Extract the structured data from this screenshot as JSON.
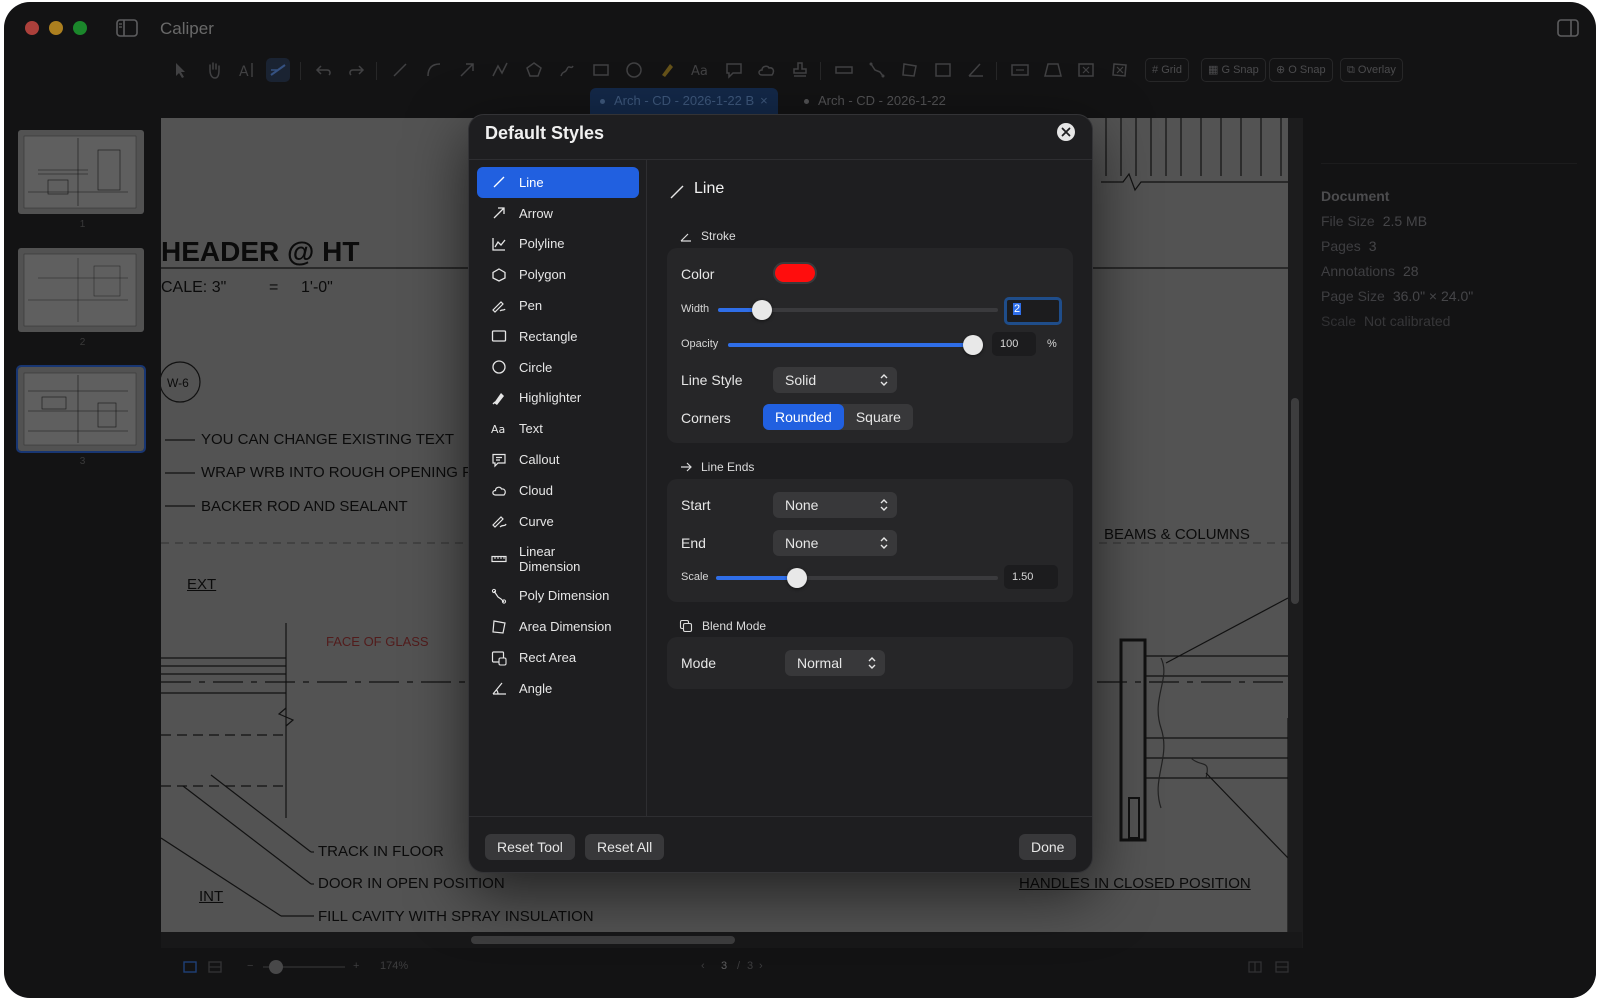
{
  "app": {
    "title": "Caliper"
  },
  "toolbar": {
    "toggles": [
      "Grid",
      "G Snap",
      "O Snap",
      "Overlay"
    ]
  },
  "tabs": [
    {
      "label": "Arch - CD - 2026-1-22 B",
      "active": true
    },
    {
      "label": "Arch - CD - 2026-1-22",
      "active": false
    }
  ],
  "thumbnails": [
    {
      "label": "1"
    },
    {
      "label": "2"
    },
    {
      "label": "3"
    }
  ],
  "drawing": {
    "title": "HEADER @ HT",
    "scale_left": "CALE: 3\"",
    "scale_eq": "=",
    "scale_right": "1'-0\"",
    "tag": "W-6",
    "notes_top": [
      "YOU CAN CHANGE EXISTING TEXT",
      "WRAP WRB INTO ROUGH OPENING F",
      "BACKER ROD AND SEALANT"
    ],
    "ext": "EXT",
    "face_of_glass": "FACE OF GLASS",
    "beams": "BEAMS & COLUMNS",
    "notes_bottom": [
      "TRACK IN FLOOR",
      "DOOR IN OPEN POSITION",
      "FILL CAVITY WITH SPRAY INSULATION"
    ],
    "int": "INT",
    "handles": "HANDLES IN CLOSED POSITION"
  },
  "inspector": {
    "heading": "Document",
    "rows": [
      {
        "label": "File Size",
        "value": "2.5 MB"
      },
      {
        "label": "Pages",
        "value": "3"
      },
      {
        "label": "Annotations",
        "value": "28"
      },
      {
        "label": "Page Size",
        "value": "36.0\" × 24.0\""
      },
      {
        "label": "Scale",
        "value": "Not calibrated"
      }
    ]
  },
  "statusbar": {
    "zoom": "174%",
    "page_current": "3",
    "page_sep": "/",
    "page_total": "3"
  },
  "modal": {
    "title": "Default Styles",
    "tools": [
      {
        "label": "Line",
        "icon": "line-icon",
        "active": true
      },
      {
        "label": "Arrow",
        "icon": "arrow-icon"
      },
      {
        "label": "Polyline",
        "icon": "polyline-icon"
      },
      {
        "label": "Polygon",
        "icon": "polygon-icon"
      },
      {
        "label": "Pen",
        "icon": "pen-icon"
      },
      {
        "label": "Rectangle",
        "icon": "rectangle-icon"
      },
      {
        "label": "Circle",
        "icon": "circle-icon"
      },
      {
        "label": "Highlighter",
        "icon": "highlighter-icon"
      },
      {
        "label": "Text",
        "icon": "text-icon"
      },
      {
        "label": "Callout",
        "icon": "callout-icon"
      },
      {
        "label": "Cloud",
        "icon": "cloud-icon"
      },
      {
        "label": "Curve",
        "icon": "curve-icon"
      },
      {
        "label": "Linear Dimension",
        "icon": "linear-dimension-icon"
      },
      {
        "label": "Poly Dimension",
        "icon": "poly-dimension-icon"
      },
      {
        "label": "Area Dimension",
        "icon": "area-dimension-icon"
      },
      {
        "label": "Rect Area",
        "icon": "rect-area-icon"
      },
      {
        "label": "Angle",
        "icon": "angle-icon"
      }
    ],
    "panel": {
      "title": "Line",
      "stroke": {
        "heading": "Stroke",
        "color_label": "Color",
        "color_value": "#ff0d0d",
        "width_label": "Width",
        "width_value": "2",
        "width_fraction": 0.13,
        "opacity_label": "Opacity",
        "opacity_value": "100",
        "opacity_unit": "%",
        "opacity_fraction": 1.0,
        "line_style_label": "Line Style",
        "line_style_value": "Solid",
        "corners_label": "Corners",
        "corners_options": [
          "Rounded",
          "Square"
        ],
        "corners_selected": "Rounded"
      },
      "line_ends": {
        "heading": "Line Ends",
        "start_label": "Start",
        "start_value": "None",
        "end_label": "End",
        "end_value": "None",
        "scale_label": "Scale",
        "scale_value": "1.50",
        "scale_fraction": 0.27
      },
      "blend": {
        "heading": "Blend Mode",
        "mode_label": "Mode",
        "mode_value": "Normal"
      }
    },
    "buttons": {
      "reset_tool": "Reset Tool",
      "reset_all": "Reset All",
      "done": "Done"
    }
  }
}
